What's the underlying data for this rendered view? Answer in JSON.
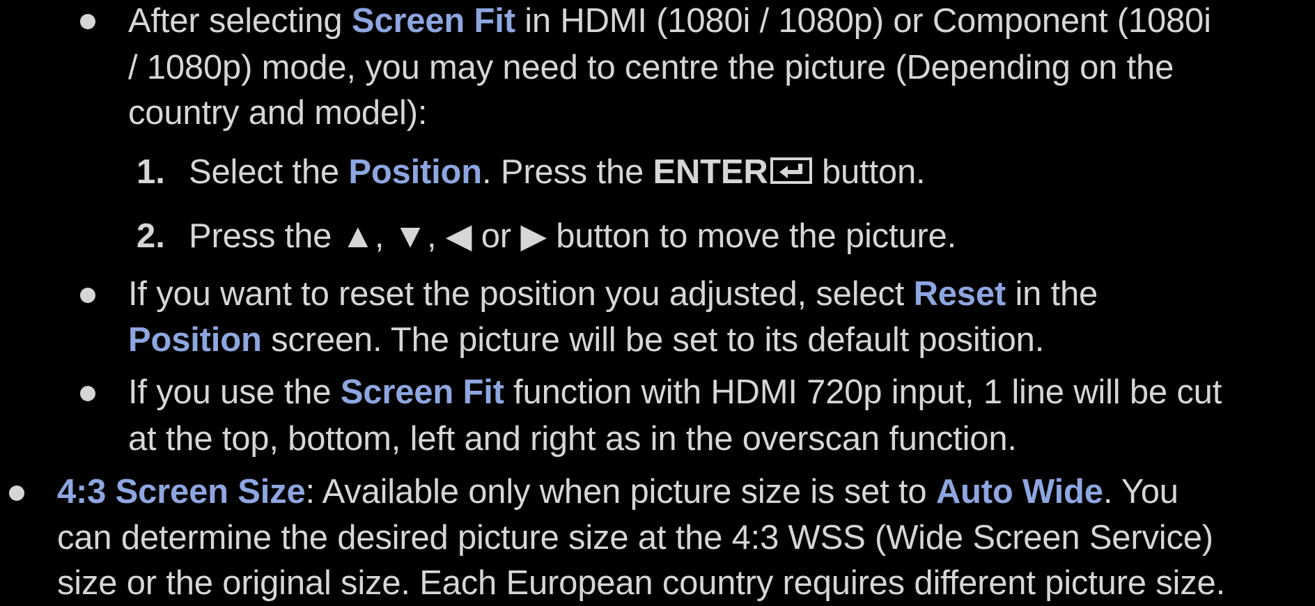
{
  "bullet1": {
    "l1a": "After selecting ",
    "l1b": "Screen Fit",
    "l1c": " in HDMI (1080i / 1080p) or Component (1080i",
    "l2": "/ 1080p) mode, you may need to centre the picture (Depending on the",
    "l3": "country and model):"
  },
  "step1": {
    "num": "1.",
    "a": "Select the ",
    "b": "Position",
    "c": ". Press the ",
    "d": "ENTER",
    "e": " button."
  },
  "step2": {
    "num": "2.",
    "text": "Press the ▲, ▼, ◀ or ▶ button to move the picture."
  },
  "bullet2": {
    "l1a": "If you want to reset the position you adjusted, select ",
    "l1b": "Reset",
    "l1c": " in the",
    "l2a": "Position",
    "l2b": " screen. The picture will be set to its default position."
  },
  "bullet3": {
    "l1a": "If you use the ",
    "l1b": "Screen Fit",
    "l1c": " function with HDMI 720p input, 1 line will be cut",
    "l2": "at the top, bottom, left and right as in the overscan function."
  },
  "bullet4": {
    "l1a": "4:3 Screen Size",
    "l1b": ": Available only when picture size is set to ",
    "l1c": "Auto Wide",
    "l1d": ". You",
    "l2": "can determine the desired picture size at the 4:3 WSS (Wide Screen Service)",
    "l3": "size or the original size. Each European country requires different picture size."
  },
  "colors": {
    "background": "#000000",
    "text": "#d6d6d6",
    "highlight": "#8ea6e0"
  },
  "icons": {
    "enter": "enter-icon"
  }
}
